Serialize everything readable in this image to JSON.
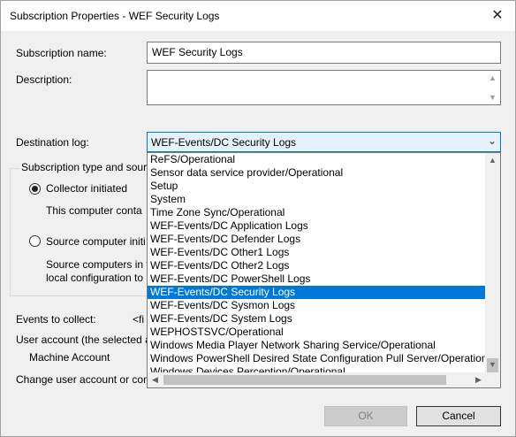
{
  "window": {
    "title": "Subscription Properties - WEF Security Logs",
    "close_glyph": "✕"
  },
  "form": {
    "subscription_name_label": "Subscription name:",
    "subscription_name_value": "WEF Security Logs",
    "description_label": "Description:",
    "description_value": "",
    "destination_log_label": "Destination log:",
    "destination_log_value": "WEF-Events/DC Security Logs",
    "subscription_type_title": "Subscription type and sour",
    "collector_initiated_label": "Collector initiated",
    "collector_initiated_desc": "This computer conta",
    "source_initiated_label": "Source computer initi",
    "source_initiated_desc_1": "Source computers in t",
    "source_initiated_desc_2": "local configuration to",
    "events_to_collect_label": "Events to collect:",
    "events_to_collect_value": "<fi",
    "user_account_label": "User account (the selected a",
    "user_account_value": "Machine Account",
    "change_user_account_label": "Change user account or con"
  },
  "dropdown": {
    "items": [
      "ReFS/Operational",
      "Sensor data service provider/Operational",
      "Setup",
      "System",
      "Time Zone Sync/Operational",
      "WEF-Events/DC Application Logs",
      "WEF-Events/DC Defender Logs",
      "WEF-Events/DC Other1 Logs",
      "WEF-Events/DC Other2 Logs",
      "WEF-Events/DC PowerShell Logs",
      "WEF-Events/DC Security Logs",
      "WEF-Events/DC Sysmon Logs",
      "WEF-Events/DC System Logs",
      "WEPHOSTSVC/Operational",
      "Windows Media Player Network Sharing Service/Operational",
      "Windows PowerShell Desired State Configuration Pull Server/Operational",
      "Windows.Devices.Perception/Operational"
    ],
    "selected_index": 10
  },
  "buttons": {
    "ok_label": "OK",
    "cancel_label": "Cancel"
  },
  "colors": {
    "selection": "#0078d7",
    "combo_background": "#e5f1fb",
    "window_background": "#f0f0f0"
  }
}
